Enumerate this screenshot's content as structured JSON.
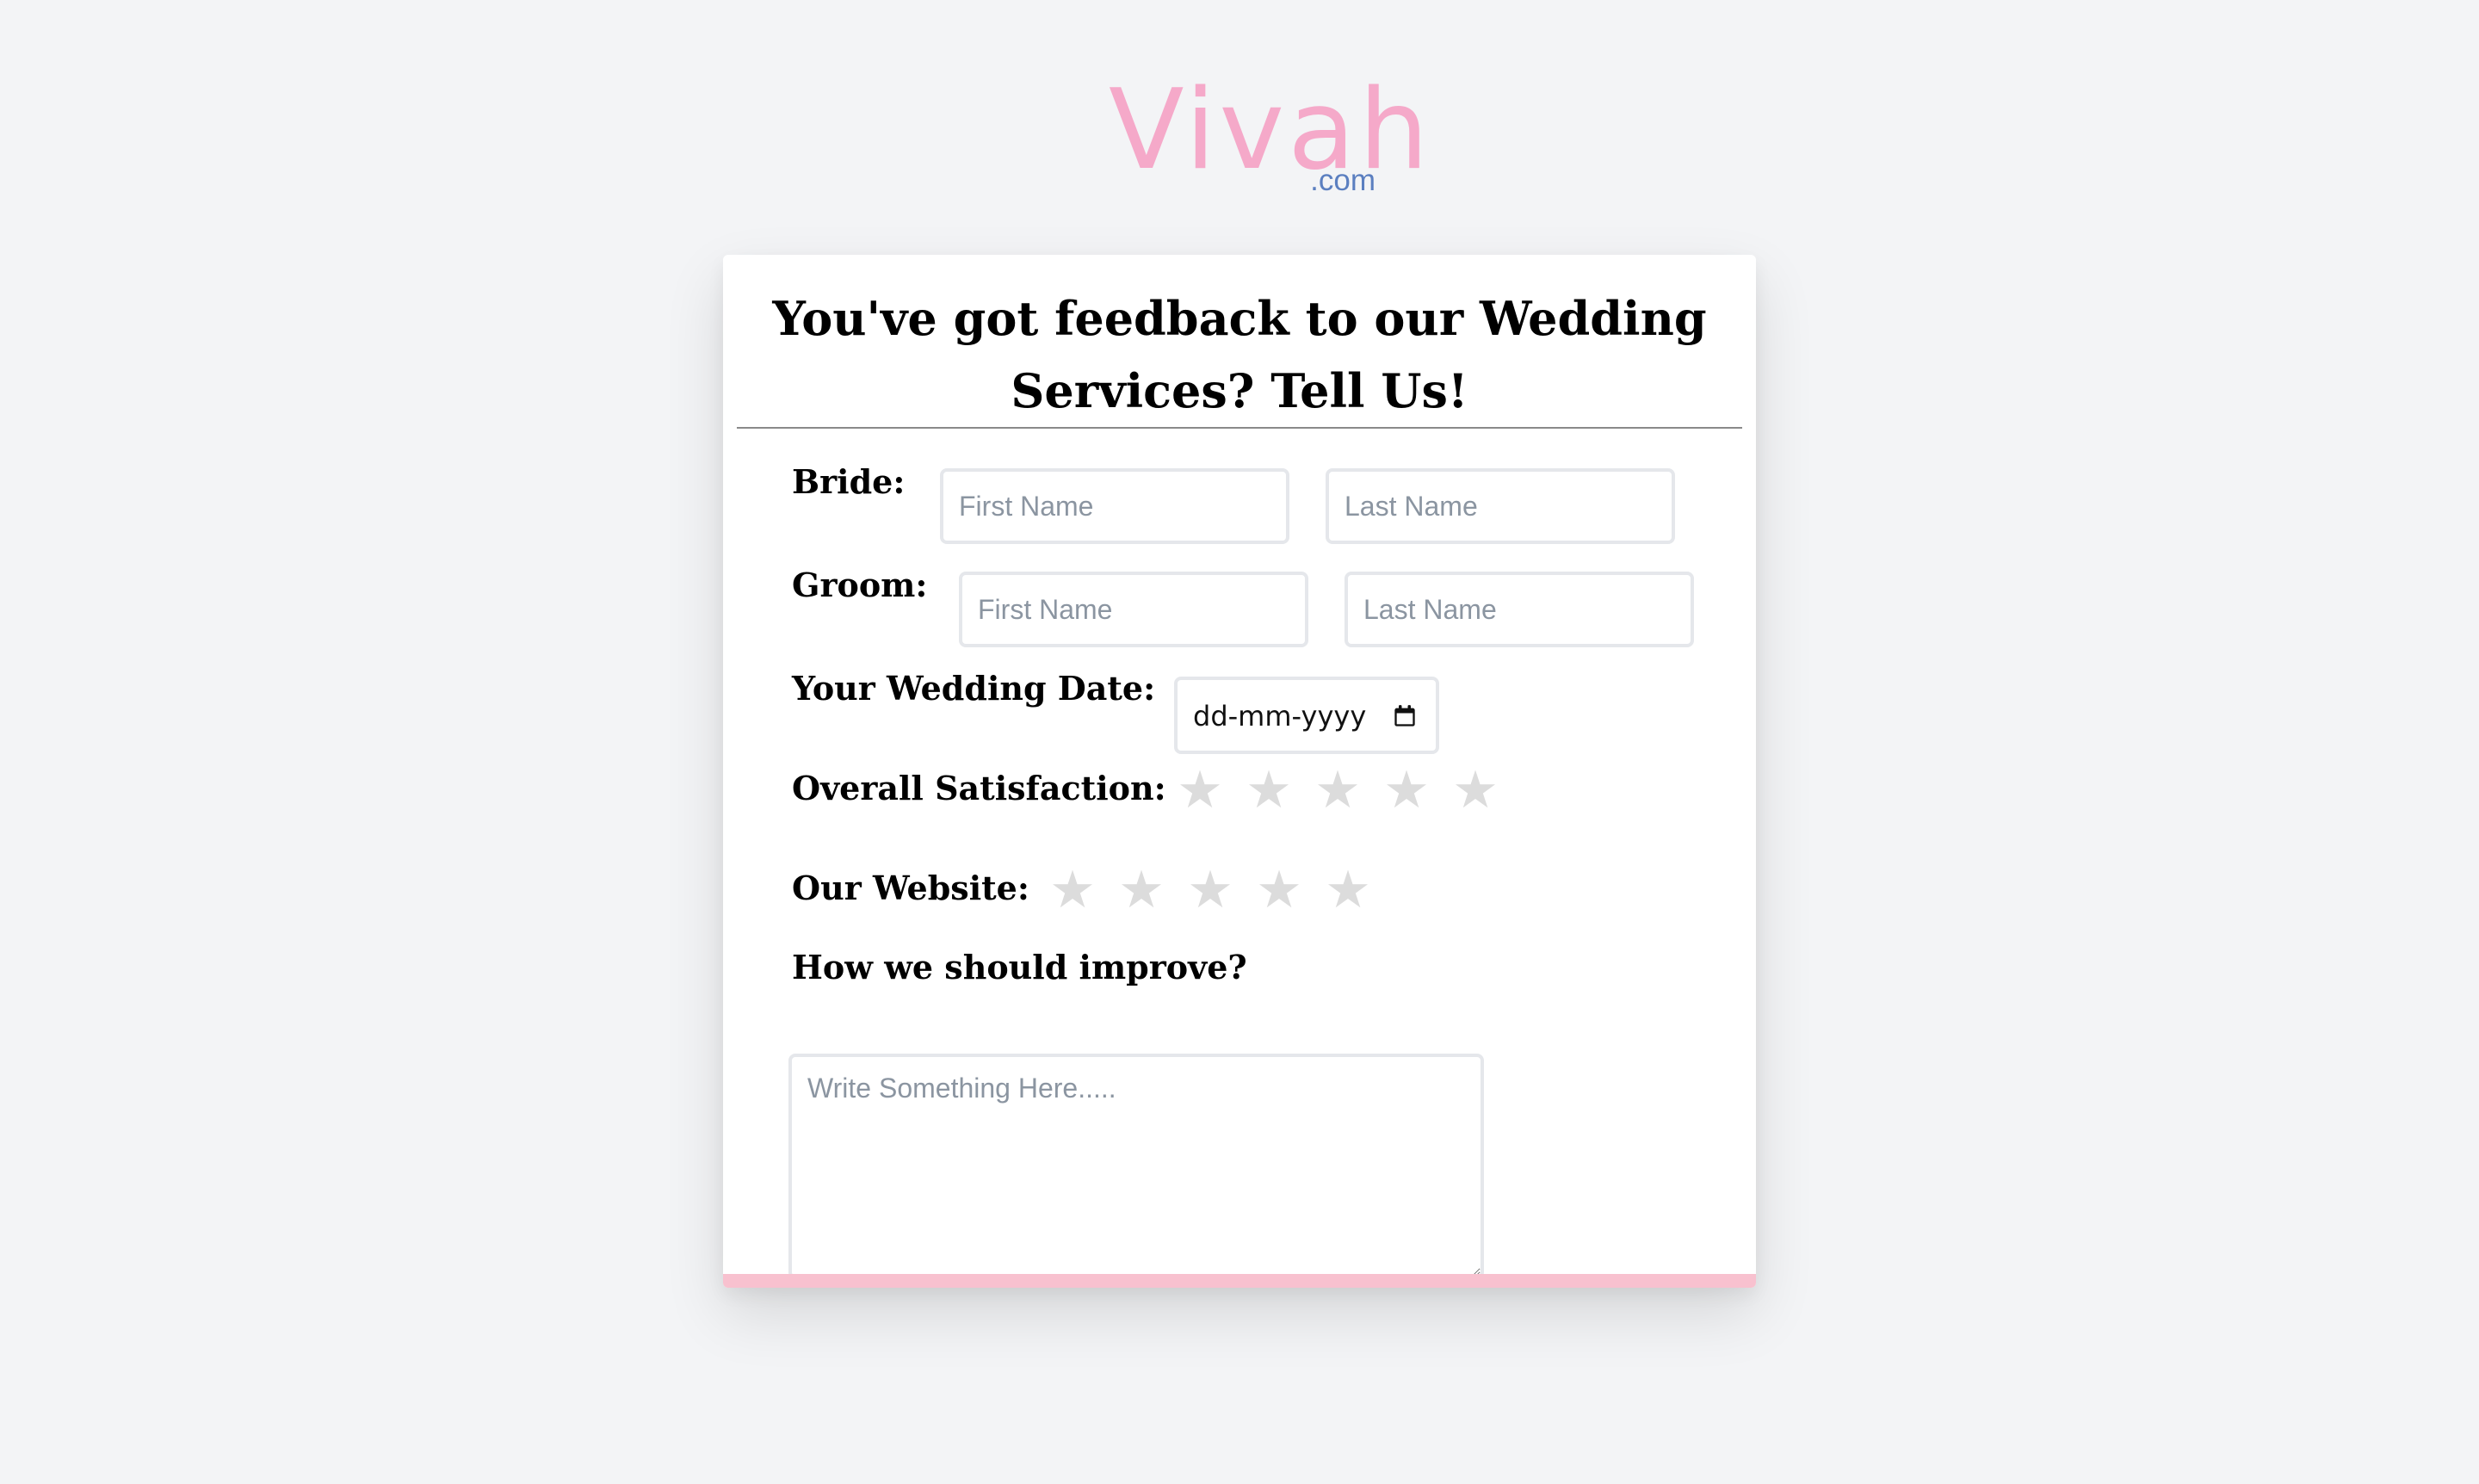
{
  "brand": {
    "name": "Vivah",
    "domain": ".com",
    "logo_color": "#f5a9c9",
    "domain_color": "#5b7fc0"
  },
  "form": {
    "title": "You've got feedback to our Wedding Services? Tell Us!",
    "bride": {
      "label": "Bride:",
      "first_placeholder": "First Name",
      "last_placeholder": "Last Name"
    },
    "groom": {
      "label": "Groom:",
      "first_placeholder": "First Name",
      "last_placeholder": "Last Name"
    },
    "wedding_date": {
      "label": "Your Wedding Date:",
      "placeholder": "dd-mm-yyyy",
      "icon": "calendar-icon"
    },
    "overall_satisfaction": {
      "label": "Overall Satisfaction:",
      "rating": 0,
      "max": 5
    },
    "our_website": {
      "label": "Our Website:",
      "rating": 0,
      "max": 5
    },
    "improve": {
      "label": "How we should improve?",
      "placeholder": "Write Something Here....."
    }
  },
  "colors": {
    "background": "#f3f4f6",
    "card": "#ffffff",
    "accent_bar": "#f8c1cf",
    "star_inactive": "#dcdcdc"
  }
}
